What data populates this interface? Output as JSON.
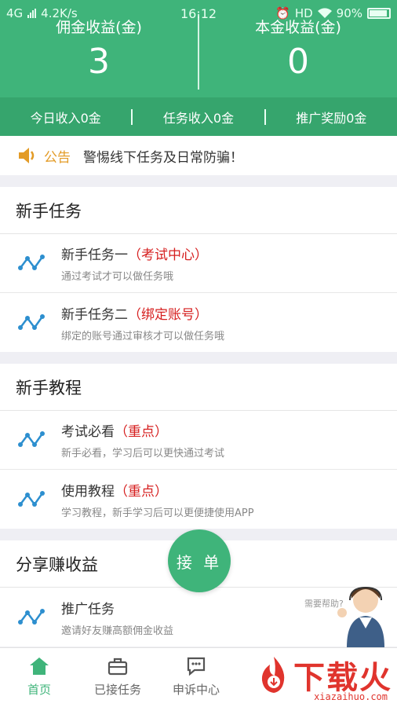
{
  "status_bar": {
    "network": "4G",
    "speed": "4.2K/s",
    "time": "16:12",
    "hd": "HD",
    "battery": "90%"
  },
  "earnings": {
    "commission_label": "佣金收益(金)",
    "commission_value": "3",
    "principal_label": "本金收益(金)",
    "principal_value": "0"
  },
  "stats": {
    "today": "今日收入0金",
    "task": "任务收入0金",
    "promo": "推广奖励0金"
  },
  "notice": {
    "label": "公告",
    "text": "警惕线下任务及日常防骗！"
  },
  "sections": {
    "newbie_tasks": {
      "title": "新手任务",
      "items": [
        {
          "title": "新手任务一",
          "tag": "（考试中心）",
          "sub": "通过考试才可以做任务哦"
        },
        {
          "title": "新手任务二",
          "tag": "（绑定账号）",
          "sub": "绑定的账号通过审核才可以做任务哦"
        }
      ]
    },
    "tutorials": {
      "title": "新手教程",
      "items": [
        {
          "title": "考试必看",
          "tag": "（重点）",
          "sub": "新手必看，学习后可以更快通过考试"
        },
        {
          "title": "使用教程",
          "tag": "（重点）",
          "sub": "学习教程，新手学习后可以更便捷使用APP"
        }
      ]
    },
    "share": {
      "title": "分享赚收益",
      "items": [
        {
          "title": "推广任务",
          "tag": "",
          "sub": "邀请好友赚高额佣金收益"
        }
      ]
    }
  },
  "fab_label": "接 单",
  "help_text": "需要帮助?",
  "tabs": [
    {
      "label": "首页",
      "icon": "home-icon"
    },
    {
      "label": "已接任务",
      "icon": "briefcase-icon"
    },
    {
      "label": "申诉中心",
      "icon": "chat-icon"
    }
  ],
  "colors": {
    "brand_green": "#3fb47a",
    "tag_red": "#d62020",
    "notice_orange": "#e39b26",
    "logo_red": "#e0342d"
  },
  "logo": {
    "text": "下载火",
    "url": "xiazaihuo.com"
  }
}
